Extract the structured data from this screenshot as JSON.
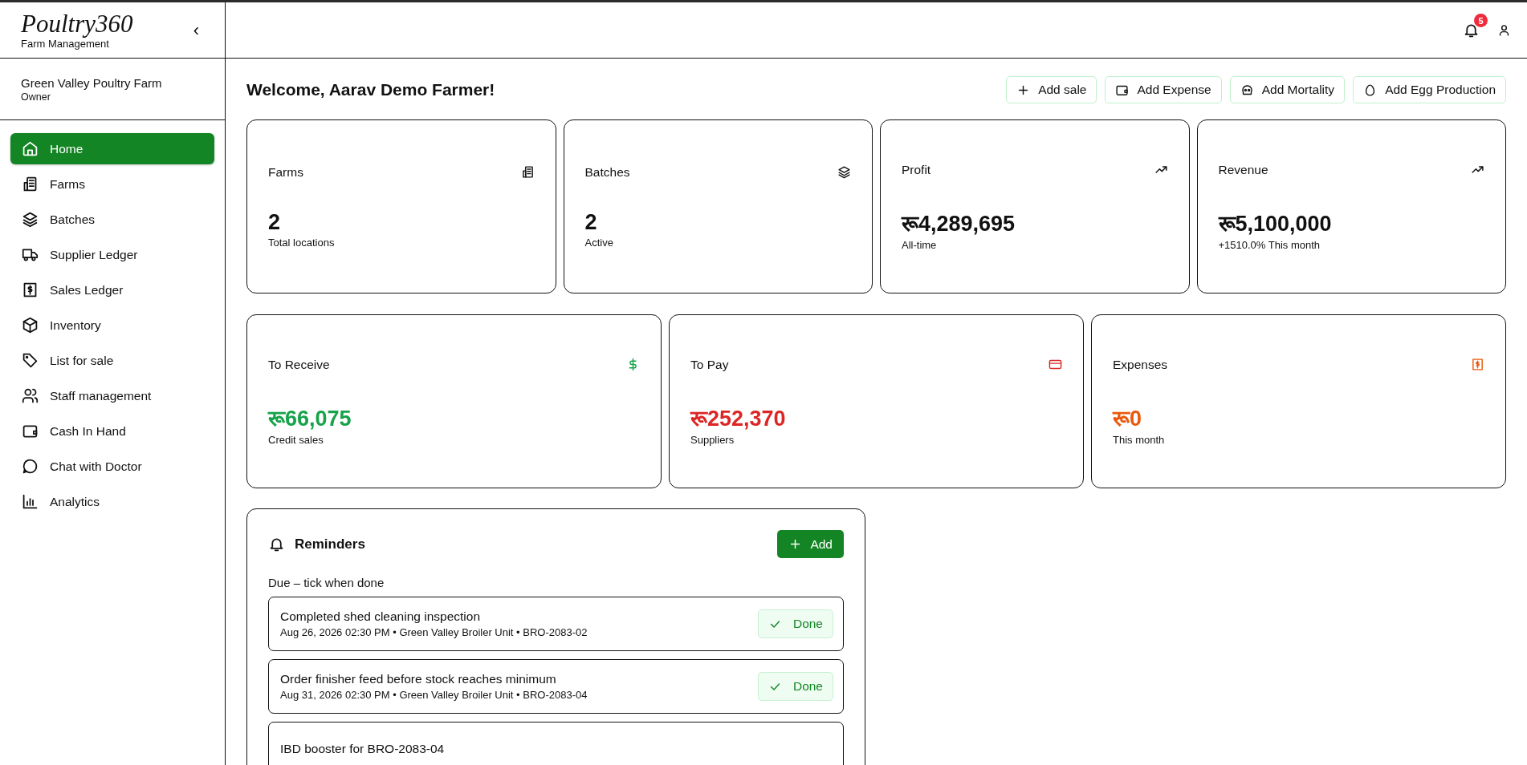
{
  "brand": {
    "logo": "Poultry360",
    "subtitle": "Farm Management",
    "collapse": "‹"
  },
  "org": {
    "name": "Green Valley Poultry Farm",
    "role": "Owner"
  },
  "nav": [
    {
      "label": "Home",
      "selected": true
    },
    {
      "label": "Farms",
      "selected": false
    },
    {
      "label": "Batches",
      "selected": false
    },
    {
      "label": "Supplier Ledger",
      "selected": false
    },
    {
      "label": "Sales Ledger",
      "selected": false
    },
    {
      "label": "Inventory",
      "selected": false
    },
    {
      "label": "List for sale",
      "selected": false
    },
    {
      "label": "Staff management",
      "selected": false
    },
    {
      "label": "Cash In Hand",
      "selected": false
    },
    {
      "label": "Chat with Doctor",
      "selected": false
    },
    {
      "label": "Analytics",
      "selected": false
    }
  ],
  "topbar": {
    "notification_count": "5"
  },
  "welcome": "Welcome, Aarav Demo Farmer!",
  "actions": [
    "Add sale",
    "Add Expense",
    "Add Mortality",
    "Add Egg Production"
  ],
  "stats": [
    {
      "title": "Farms",
      "value": "2",
      "caption": "Total locations"
    },
    {
      "title": "Batches",
      "value": "2",
      "caption": "Active"
    },
    {
      "title": "Profit",
      "value": "रू4,289,695",
      "caption": "All-time"
    },
    {
      "title": "Revenue",
      "value": "रू5,100,000",
      "caption": "+1510.0% This month"
    }
  ],
  "balances": [
    {
      "title": "To Receive",
      "value": "रू66,075",
      "caption": "Credit sales",
      "color": "#16a34a"
    },
    {
      "title": "To Pay",
      "value": "रू252,370",
      "caption": "Suppliers",
      "color": "#dc2626"
    },
    {
      "title": "Expenses",
      "value": "रू0",
      "caption": "This month",
      "color": "#ea580c"
    }
  ],
  "reminders": {
    "title": "Reminders",
    "add": "Add",
    "subtitle": "Due – tick when done",
    "items": [
      {
        "title": "Completed shed cleaning inspection",
        "meta": "Aug 26, 2026 02:30 PM • Green Valley Broiler Unit • BRO-2083-02",
        "action": "Done"
      },
      {
        "title": "Order finisher feed before stock reaches minimum",
        "meta": "Aug 31, 2026 02:30 PM • Green Valley Broiler Unit • BRO-2083-04",
        "action": "Done"
      },
      {
        "title": "IBD booster for BRO-2083-04"
      }
    ]
  }
}
